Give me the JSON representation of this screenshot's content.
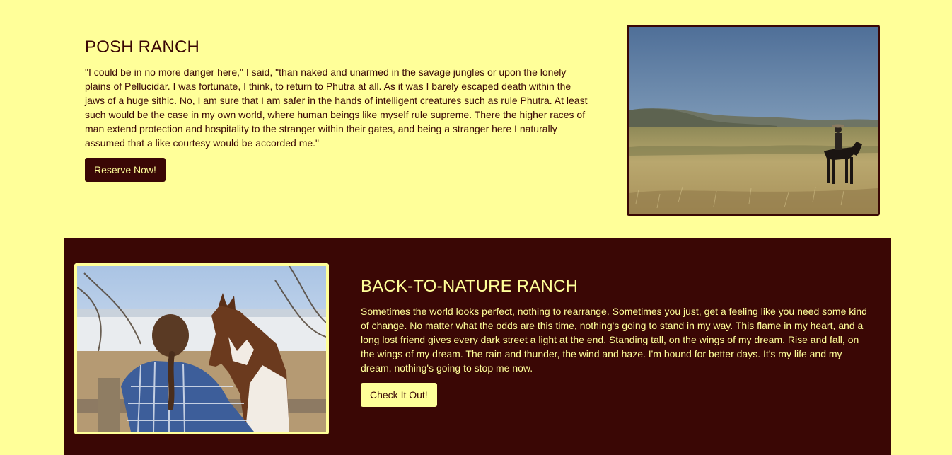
{
  "posh": {
    "title": "POSH RANCH",
    "text": "\"I could be in no more danger here,\" I said, \"than naked and unarmed in the savage jungles or upon the lonely plains of Pellucidar. I was fortunate, I think, to return to Phutra at all. As it was I barely escaped death within the jaws of a huge sithic. No, I am sure that I am safer in the hands of intelligent creatures such as rule Phutra. At least such would be the case in my own world, where human beings like myself rule supreme. There the higher races of man extend protection and hospitality to the stranger within their gates, and being a stranger here I naturally assumed that a like courtesy would be accorded me.\"",
    "button": "Reserve Now!"
  },
  "nature": {
    "title": "BACK-TO-NATURE RANCH",
    "text": "Sometimes the world looks perfect, nothing to rearrange. Sometimes you just, get a feeling like you need some kind of change. No matter what the odds are this time, nothing's going to stand in my way. This flame in my heart, and a long lost friend gives every dark street a light at the end. Standing tall, on the wings of my dream. Rise and fall, on the wings of my dream. The rain and thunder, the wind and haze. I'm bound for better days. It's my life and my dream, nothing's going to stop me now.",
    "button": "Check It Out!"
  },
  "colors": {
    "background": "#ffff99",
    "dark": "#3a0705"
  }
}
